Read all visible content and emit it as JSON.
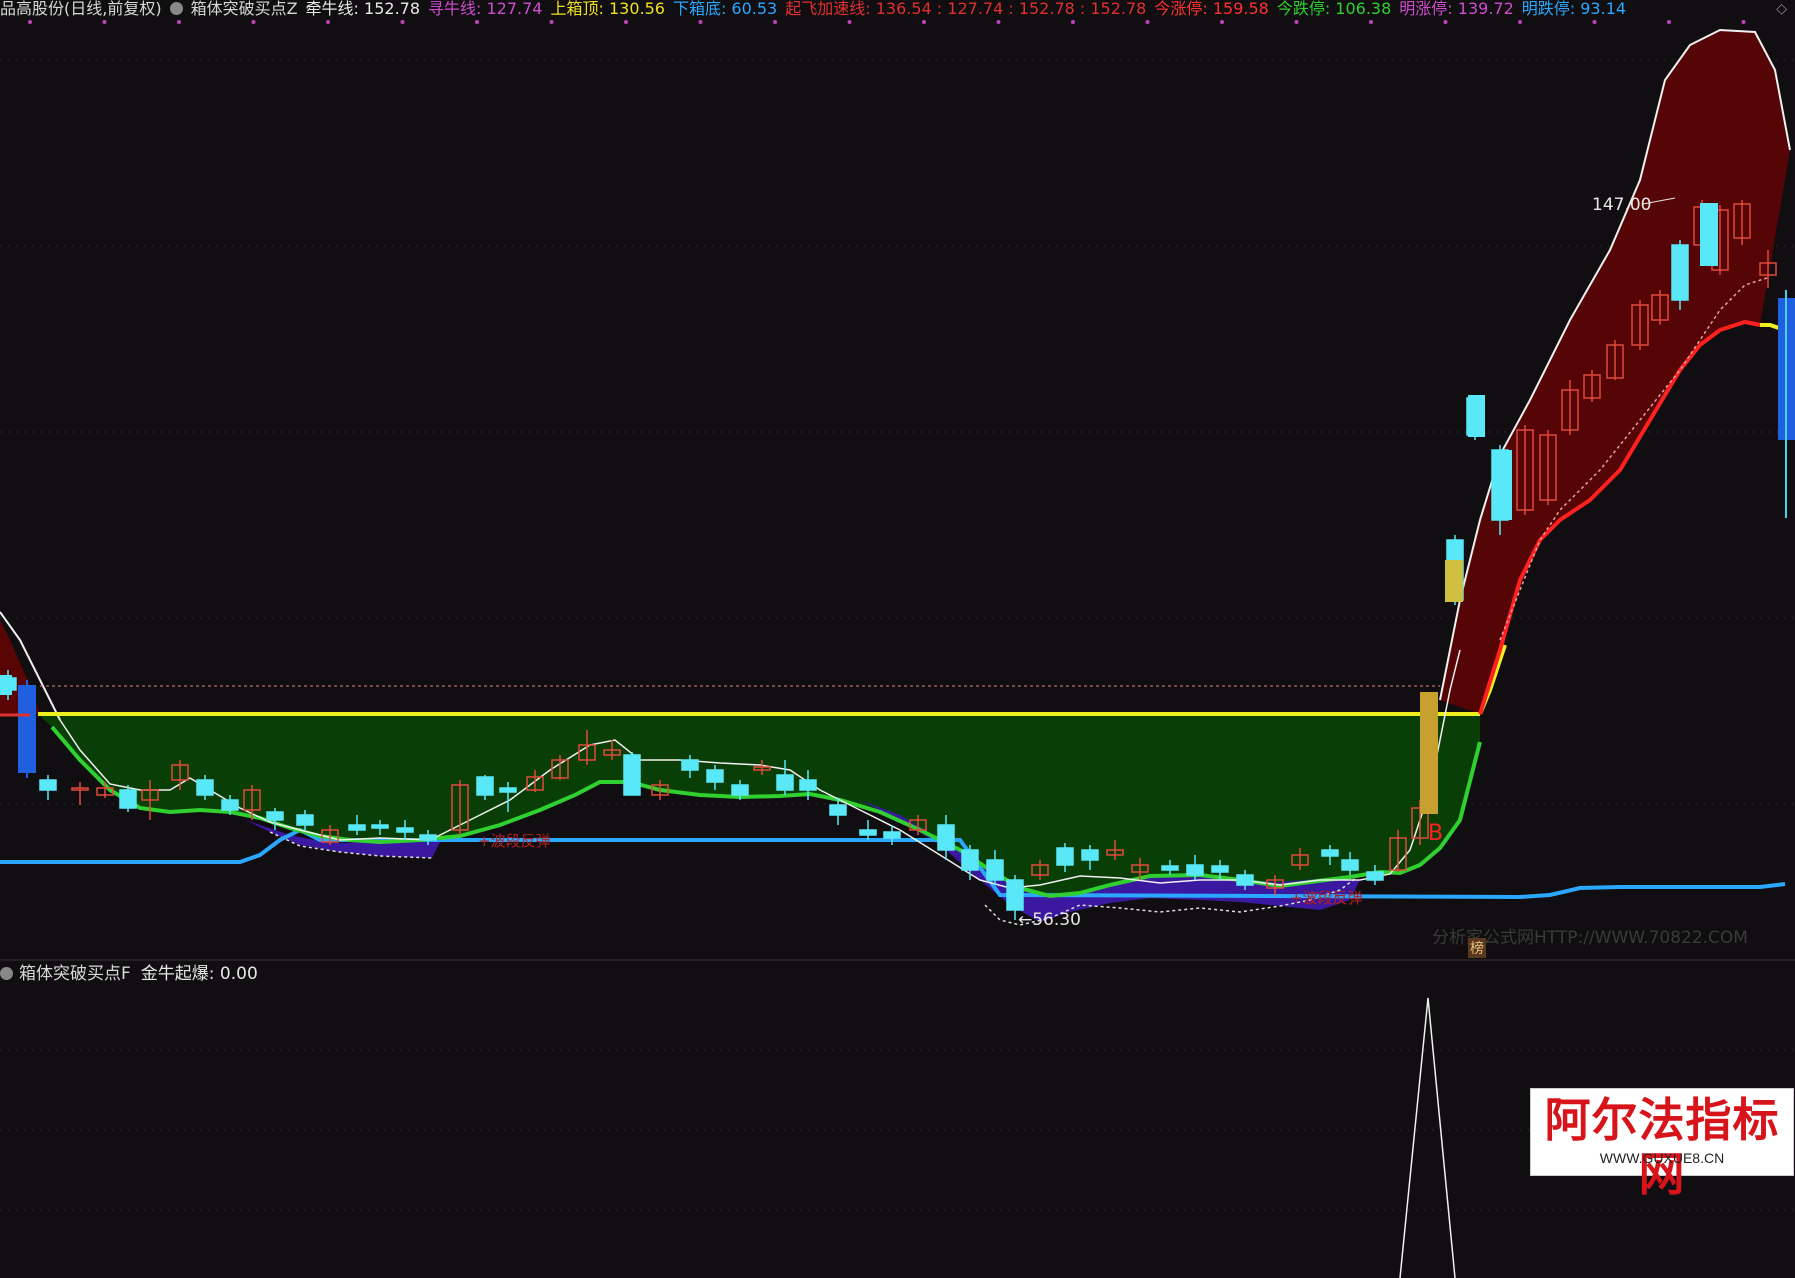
{
  "header": {
    "stock_title": "品高股份(日线,前复权)",
    "indicator_name": "箱体突破买点Z",
    "items": [
      {
        "label": "牵牛线: 152.78",
        "color": "#e8e8e8"
      },
      {
        "label": "寻牛线: 127.74",
        "color": "#d04bd0"
      },
      {
        "label": "上箱顶: 130.56",
        "color": "#f0e020"
      },
      {
        "label": "下箱底: 60.53",
        "color": "#2aa8ff"
      },
      {
        "label": "起飞加速线: 136.54 : 127.74 : 152.78 : 152.78",
        "color": "#e03030"
      },
      {
        "label": "今涨停: 159.58",
        "color": "#ff3030"
      },
      {
        "label": "今跌停: 106.38",
        "color": "#30d030"
      },
      {
        "label": "明涨停: 139.72",
        "color": "#d04bd0"
      },
      {
        "label": "明跌停: 93.14",
        "color": "#2aa8ff"
      }
    ]
  },
  "annotations": {
    "high_price": "147.00",
    "low_price": "56.30",
    "buy_marker": "B",
    "bottom_label_1": "波段反弹",
    "bottom_label_2": "波段反弹",
    "list_badge": "榜",
    "site_watermark": "分析家公式网HTTP://WWW.70822.COM"
  },
  "sub_panel": {
    "indicator_name": "箱体突破买点F",
    "value_label": "金牛起爆: 0.00"
  },
  "watermark": {
    "title": "阿尔法指标网",
    "url": "WWW.GUXUE8.CN"
  },
  "colors": {
    "background": "#100e10",
    "bull_candle": "#e04a3a",
    "bear_candle": "#58e8f8",
    "box_fill": "#0a4206",
    "box_top_line": "#f0f020",
    "ma_green": "#30d030",
    "support_blue": "#2aa8ff",
    "upper_band_fill": "#5a0505",
    "accel_red": "#ff2020"
  }
}
